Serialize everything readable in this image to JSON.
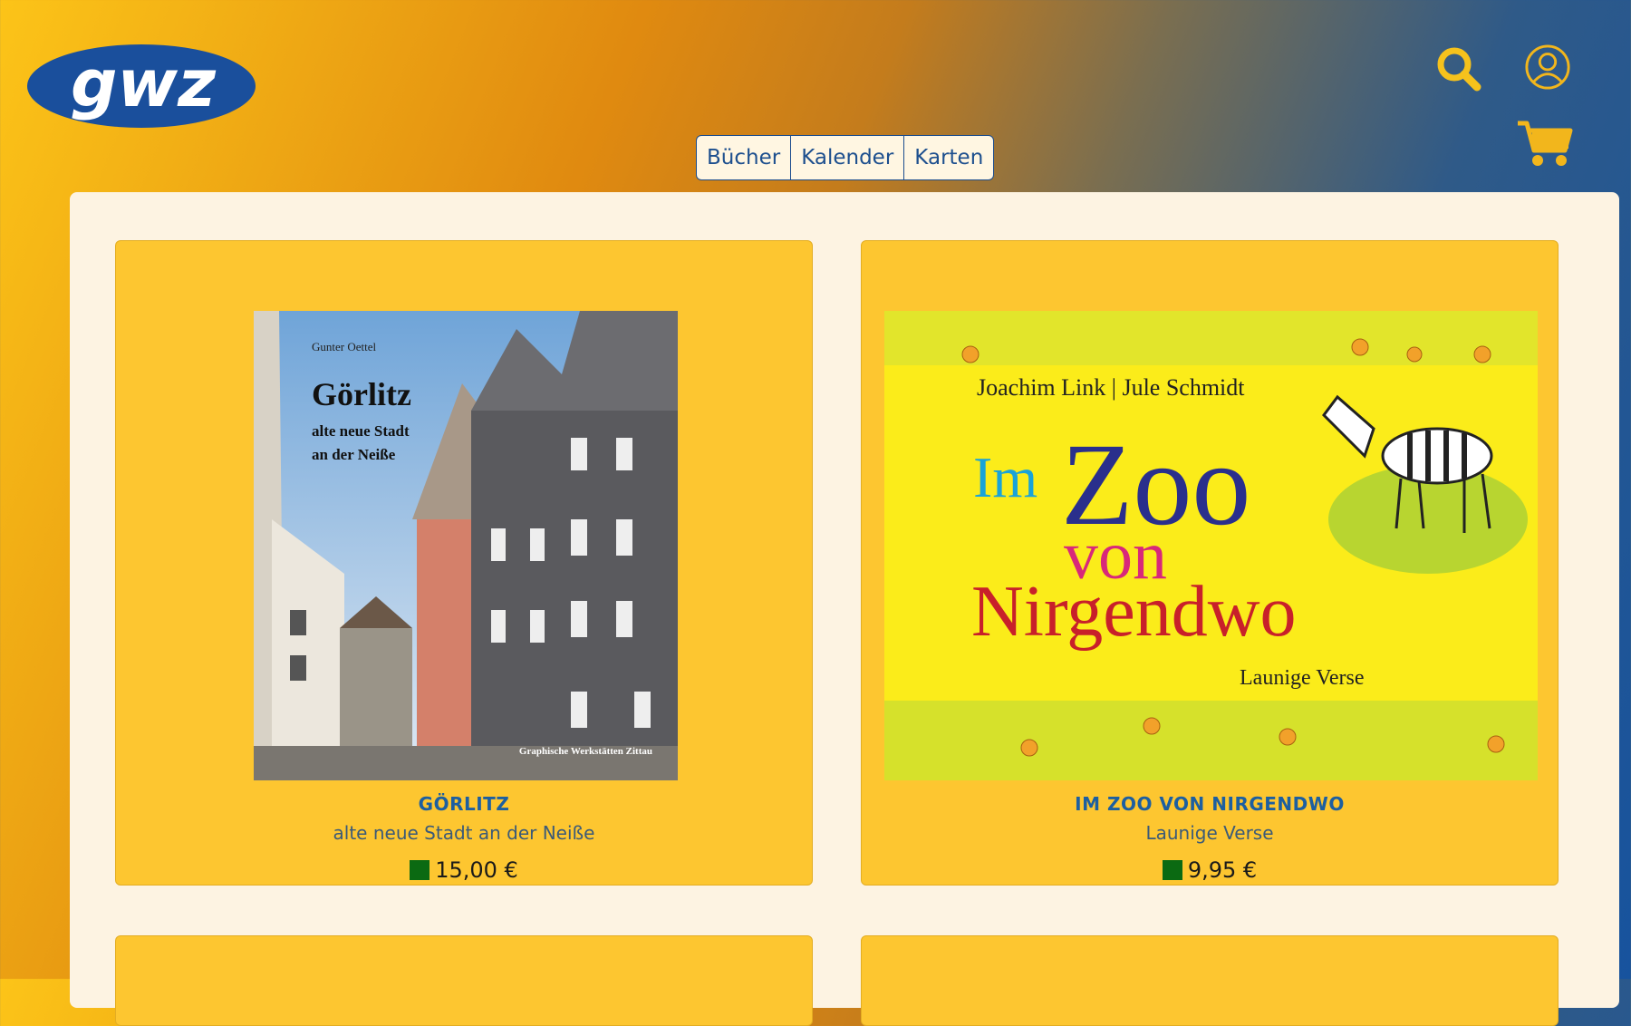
{
  "header": {
    "logo_text": "gwz",
    "icons": {
      "search": "search-icon",
      "account": "user-circle-icon",
      "cart": "cart-icon"
    },
    "accent_color": "#f6c21c",
    "brand_blue": "#1a4f9c"
  },
  "nav": {
    "tabs": [
      {
        "label": "Bücher"
      },
      {
        "label": "Kalender"
      },
      {
        "label": "Karten"
      }
    ]
  },
  "products": [
    {
      "title": "GÖRLITZ",
      "subtitle": "alte neue Stadt an der Neiße",
      "price": "15,00 €",
      "availability_color": "#0b6a12",
      "cover": {
        "author": "Gunter Oettel",
        "title": "Görlitz",
        "subtitle_line1": "alte neue Stadt",
        "subtitle_line2": "an der Neiße",
        "publisher": "Graphische Werkstätten Zittau"
      }
    },
    {
      "title": "IM ZOO VON NIRGENDWO",
      "subtitle": "Launige Verse",
      "price": "9,95 €",
      "availability_color": "#0b6a12",
      "cover": {
        "authors": "Joachim Link | Jule Schmidt",
        "title_word1": "Im",
        "title_word2": "Zoo",
        "title_word3": "von",
        "title_word4": "Nirgendwo",
        "subtitle": "Launige Verse"
      }
    }
  ]
}
